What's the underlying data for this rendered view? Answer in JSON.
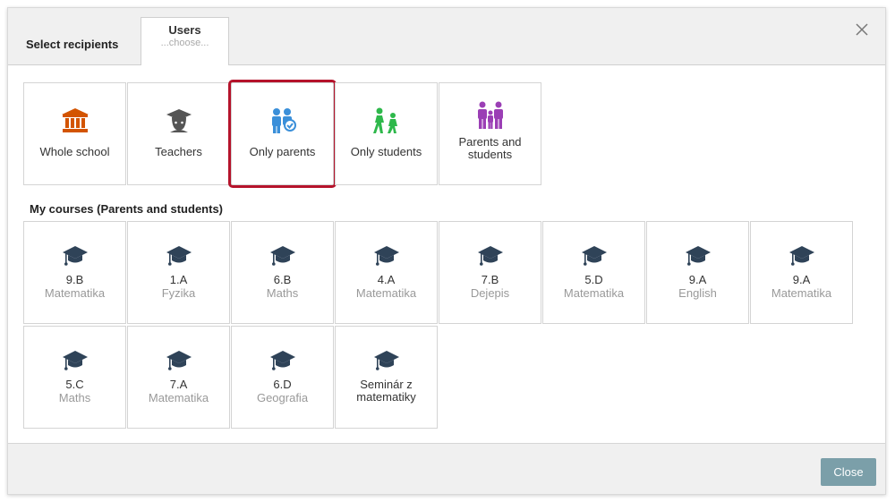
{
  "header": {
    "title": "Select recipients",
    "tab_label": "Users",
    "tab_sub": "...choose..."
  },
  "recipient_types": [
    {
      "label": "Whole school",
      "icon": "building-icon",
      "color": "#d35400"
    },
    {
      "label": "Teachers",
      "icon": "teacher-icon",
      "color": "#555555"
    },
    {
      "label": "Only parents",
      "icon": "parents-icon",
      "color": "#3a8fd9",
      "selected": true
    },
    {
      "label": "Only students",
      "icon": "students-icon",
      "color": "#2eb84b"
    },
    {
      "label": "Parents and students",
      "icon": "family-icon",
      "color": "#9b3fb5"
    }
  ],
  "courses_title": "My courses (Parents and students)",
  "courses": [
    {
      "name": "9.B",
      "subject": "Matematika"
    },
    {
      "name": "1.A",
      "subject": "Fyzika"
    },
    {
      "name": "6.B",
      "subject": "Maths"
    },
    {
      "name": "4.A",
      "subject": "Matematika"
    },
    {
      "name": "7.B",
      "subject": "Dejepis"
    },
    {
      "name": "5.D",
      "subject": "Matematika"
    },
    {
      "name": "9.A",
      "subject": "English"
    },
    {
      "name": "9.A",
      "subject": "Matematika"
    },
    {
      "name": "5.C",
      "subject": "Maths"
    },
    {
      "name": "7.A",
      "subject": "Matematika"
    },
    {
      "name": "6.D",
      "subject": "Geografia"
    },
    {
      "name": "Seminár z matematiky",
      "subject": ""
    }
  ],
  "footer": {
    "close_label": "Close"
  },
  "colors": {
    "accent": "#7b9fa9",
    "selected_outline": "#b5132b",
    "course_icon": "#2f4358"
  }
}
